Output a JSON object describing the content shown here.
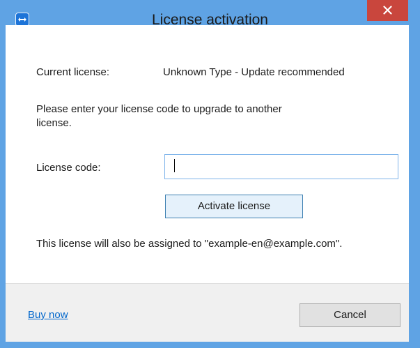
{
  "window": {
    "title": "License activation",
    "accent_color": "#5fa3e4",
    "close_color": "#c9463d"
  },
  "content": {
    "current_license_label": "Current license:",
    "current_license_value": "Unknown Type - Update recommended",
    "instruction_line1": "Please enter your license code to upgrade to another",
    "instruction_line2": "license.",
    "license_code_label": "License code:",
    "license_code_value": "",
    "activate_button": "Activate license",
    "assignment_note": "This license will also be assigned to \"example-en@example.com\"."
  },
  "footer": {
    "buy_now_link": "Buy now",
    "cancel_button": "Cancel"
  },
  "icons": {
    "app_icon": "teamviewer-icon",
    "close_icon": "close-icon"
  }
}
